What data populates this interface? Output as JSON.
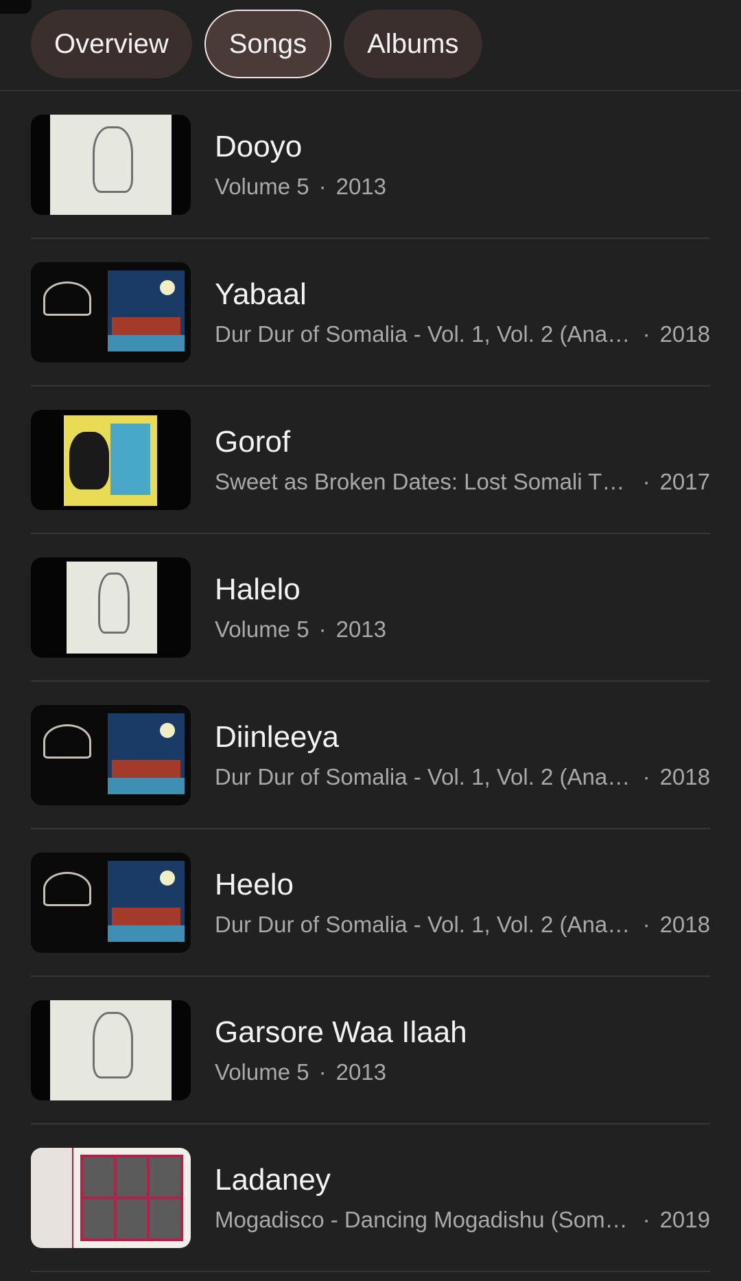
{
  "tabs": [
    {
      "label": "Overview",
      "active": false
    },
    {
      "label": "Songs",
      "active": true
    },
    {
      "label": "Albums",
      "active": false
    }
  ],
  "songs": [
    {
      "title": "Dooyo",
      "album": "Volume 5",
      "year": "2013",
      "art": "volume-5-art"
    },
    {
      "title": "Yabaal",
      "album": "Dur Dur of Somalia - Vol. 1, Vol. 2 (Anal…",
      "year": "2018",
      "art": "dur-dur-of-somalia-art"
    },
    {
      "title": "Gorof",
      "album": "Sweet as Broken Dates: Lost Somali T…",
      "year": "2017",
      "art": "sweet-as-broken-dates-art"
    },
    {
      "title": "Halelo",
      "album": "Volume 5",
      "year": "2013",
      "art": "volume-5-art"
    },
    {
      "title": "Diinleeya",
      "album": "Dur Dur of Somalia - Vol. 1, Vol. 2 (Anal…",
      "year": "2018",
      "art": "dur-dur-of-somalia-art"
    },
    {
      "title": "Heelo",
      "album": "Dur Dur of Somalia - Vol. 1, Vol. 2 (Anal…",
      "year": "2018",
      "art": "dur-dur-of-somalia-art"
    },
    {
      "title": "Garsore Waa Ilaah",
      "album": "Volume 5",
      "year": "2013",
      "art": "volume-5-art"
    },
    {
      "title": "Ladaney",
      "album": "Mogadisco - Dancing Mogadishu (Som…",
      "year": "2019",
      "art": "mogadisco-art"
    }
  ],
  "separator": "·",
  "colors": {
    "background": "#212121",
    "chip": "#3b2f2e",
    "chip_active_border": "#efe6e4",
    "subtitle": "#a9a9a9"
  }
}
